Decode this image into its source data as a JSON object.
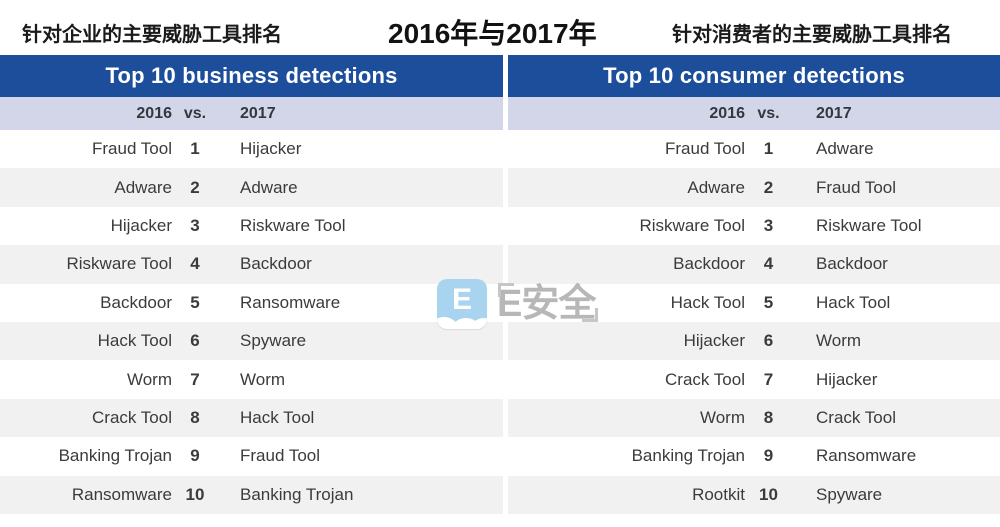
{
  "header": {
    "left_caption": "针对企业的主要威胁工具排名",
    "center_caption": "2016年与2017年",
    "right_caption": "针对消费者的主要威胁工具排名"
  },
  "colors": {
    "header_blue": "#1c4e9c",
    "subheader_lavender": "#d2d6e8",
    "stripe_gray": "#f1f1f1",
    "text_dark": "#3b3b3b",
    "watermark_gray": "#b7b7b7",
    "logo_blue": "#a8d4f0"
  },
  "panels": [
    {
      "title": "Top 10 business detections",
      "columns": [
        "2016",
        "vs.",
        "2017"
      ],
      "rows": [
        {
          "prev": "Fraud Tool",
          "rank": "1",
          "next": "Hijacker"
        },
        {
          "prev": "Adware",
          "rank": "2",
          "next": "Adware"
        },
        {
          "prev": "Hijacker",
          "rank": "3",
          "next": "Riskware Tool"
        },
        {
          "prev": "Riskware Tool",
          "rank": "4",
          "next": "Backdoor"
        },
        {
          "prev": "Backdoor",
          "rank": "5",
          "next": "Ransomware"
        },
        {
          "prev": "Hack Tool",
          "rank": "6",
          "next": "Spyware"
        },
        {
          "prev": "Worm",
          "rank": "7",
          "next": "Worm"
        },
        {
          "prev": "Crack Tool",
          "rank": "8",
          "next": "Hack Tool"
        },
        {
          "prev": "Banking Trojan",
          "rank": "9",
          "next": "Fraud Tool"
        },
        {
          "prev": "Ransomware",
          "rank": "10",
          "next": "Banking Trojan"
        }
      ]
    },
    {
      "title": "Top 10 consumer detections",
      "columns": [
        "2016",
        "vs.",
        "2017"
      ],
      "rows": [
        {
          "prev": "Fraud Tool",
          "rank": "1",
          "next": "Adware"
        },
        {
          "prev": "Adware",
          "rank": "2",
          "next": "Fraud Tool"
        },
        {
          "prev": "Riskware Tool",
          "rank": "3",
          "next": "Riskware Tool"
        },
        {
          "prev": "Backdoor",
          "rank": "4",
          "next": "Backdoor"
        },
        {
          "prev": "Hack Tool",
          "rank": "5",
          "next": "Hack Tool"
        },
        {
          "prev": "Hijacker",
          "rank": "6",
          "next": "Worm"
        },
        {
          "prev": "Crack Tool",
          "rank": "7",
          "next": "Hijacker"
        },
        {
          "prev": "Worm",
          "rank": "8",
          "next": "Crack Tool"
        },
        {
          "prev": "Banking Trojan",
          "rank": "9",
          "next": "Ransomware"
        },
        {
          "prev": "Rootkit",
          "rank": "10",
          "next": "Spyware"
        }
      ]
    }
  ],
  "watermark": {
    "logo_letter": "E",
    "text": "E安全"
  }
}
